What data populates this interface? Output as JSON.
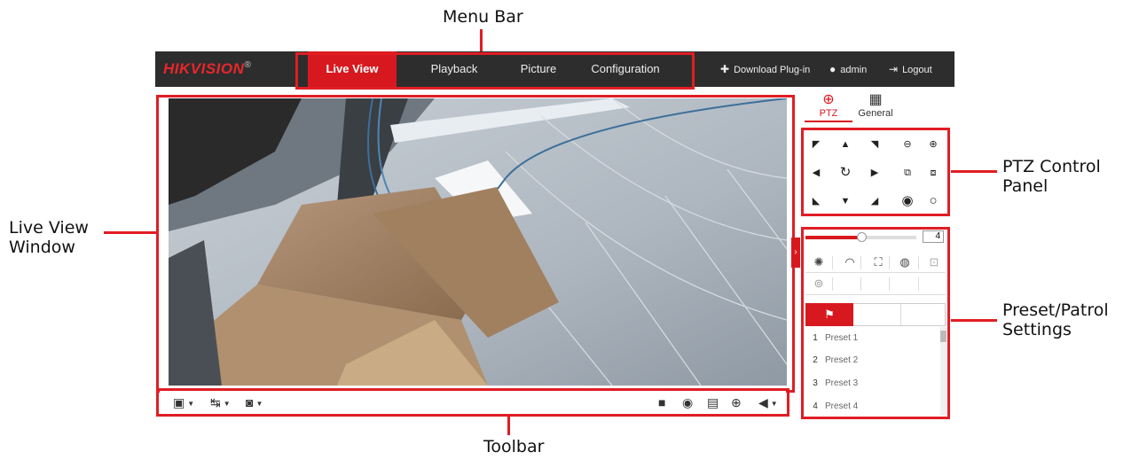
{
  "callouts": {
    "menu_bar": "Menu Bar",
    "live_view": "Live View\nWindow",
    "live_view_l1": "Live View",
    "live_view_l2": "Window",
    "ptz_l1": "PTZ Control",
    "ptz_l2": "Panel",
    "preset_l1": "Preset/Patrol",
    "preset_l2": "Settings",
    "toolbar": "Toolbar"
  },
  "header": {
    "logo": "HIKVISION",
    "logo_mark": "®",
    "tabs": [
      {
        "label": "Live View",
        "active": true
      },
      {
        "label": "Playback",
        "active": false
      },
      {
        "label": "Picture",
        "active": false
      },
      {
        "label": "Configuration",
        "active": false
      }
    ],
    "download_plugin": "Download Plug-in",
    "user": "admin",
    "logout": "Logout"
  },
  "ptz_tabs": [
    {
      "label": "PTZ",
      "icon": "crosshair-icon",
      "active": true
    },
    {
      "label": "General",
      "icon": "grid-icon",
      "active": false
    }
  ],
  "ptz": {
    "speed_value": "4",
    "speed_fraction": 0.5
  },
  "presets": [
    {
      "num": "1",
      "name": "Preset 1"
    },
    {
      "num": "2",
      "name": "Preset 2"
    },
    {
      "num": "3",
      "name": "Preset 3"
    },
    {
      "num": "4",
      "name": "Preset 4"
    }
  ],
  "colors": {
    "accent": "#d7191f",
    "annotation": "#e11d24",
    "header_bg": "#2d2d2d"
  }
}
